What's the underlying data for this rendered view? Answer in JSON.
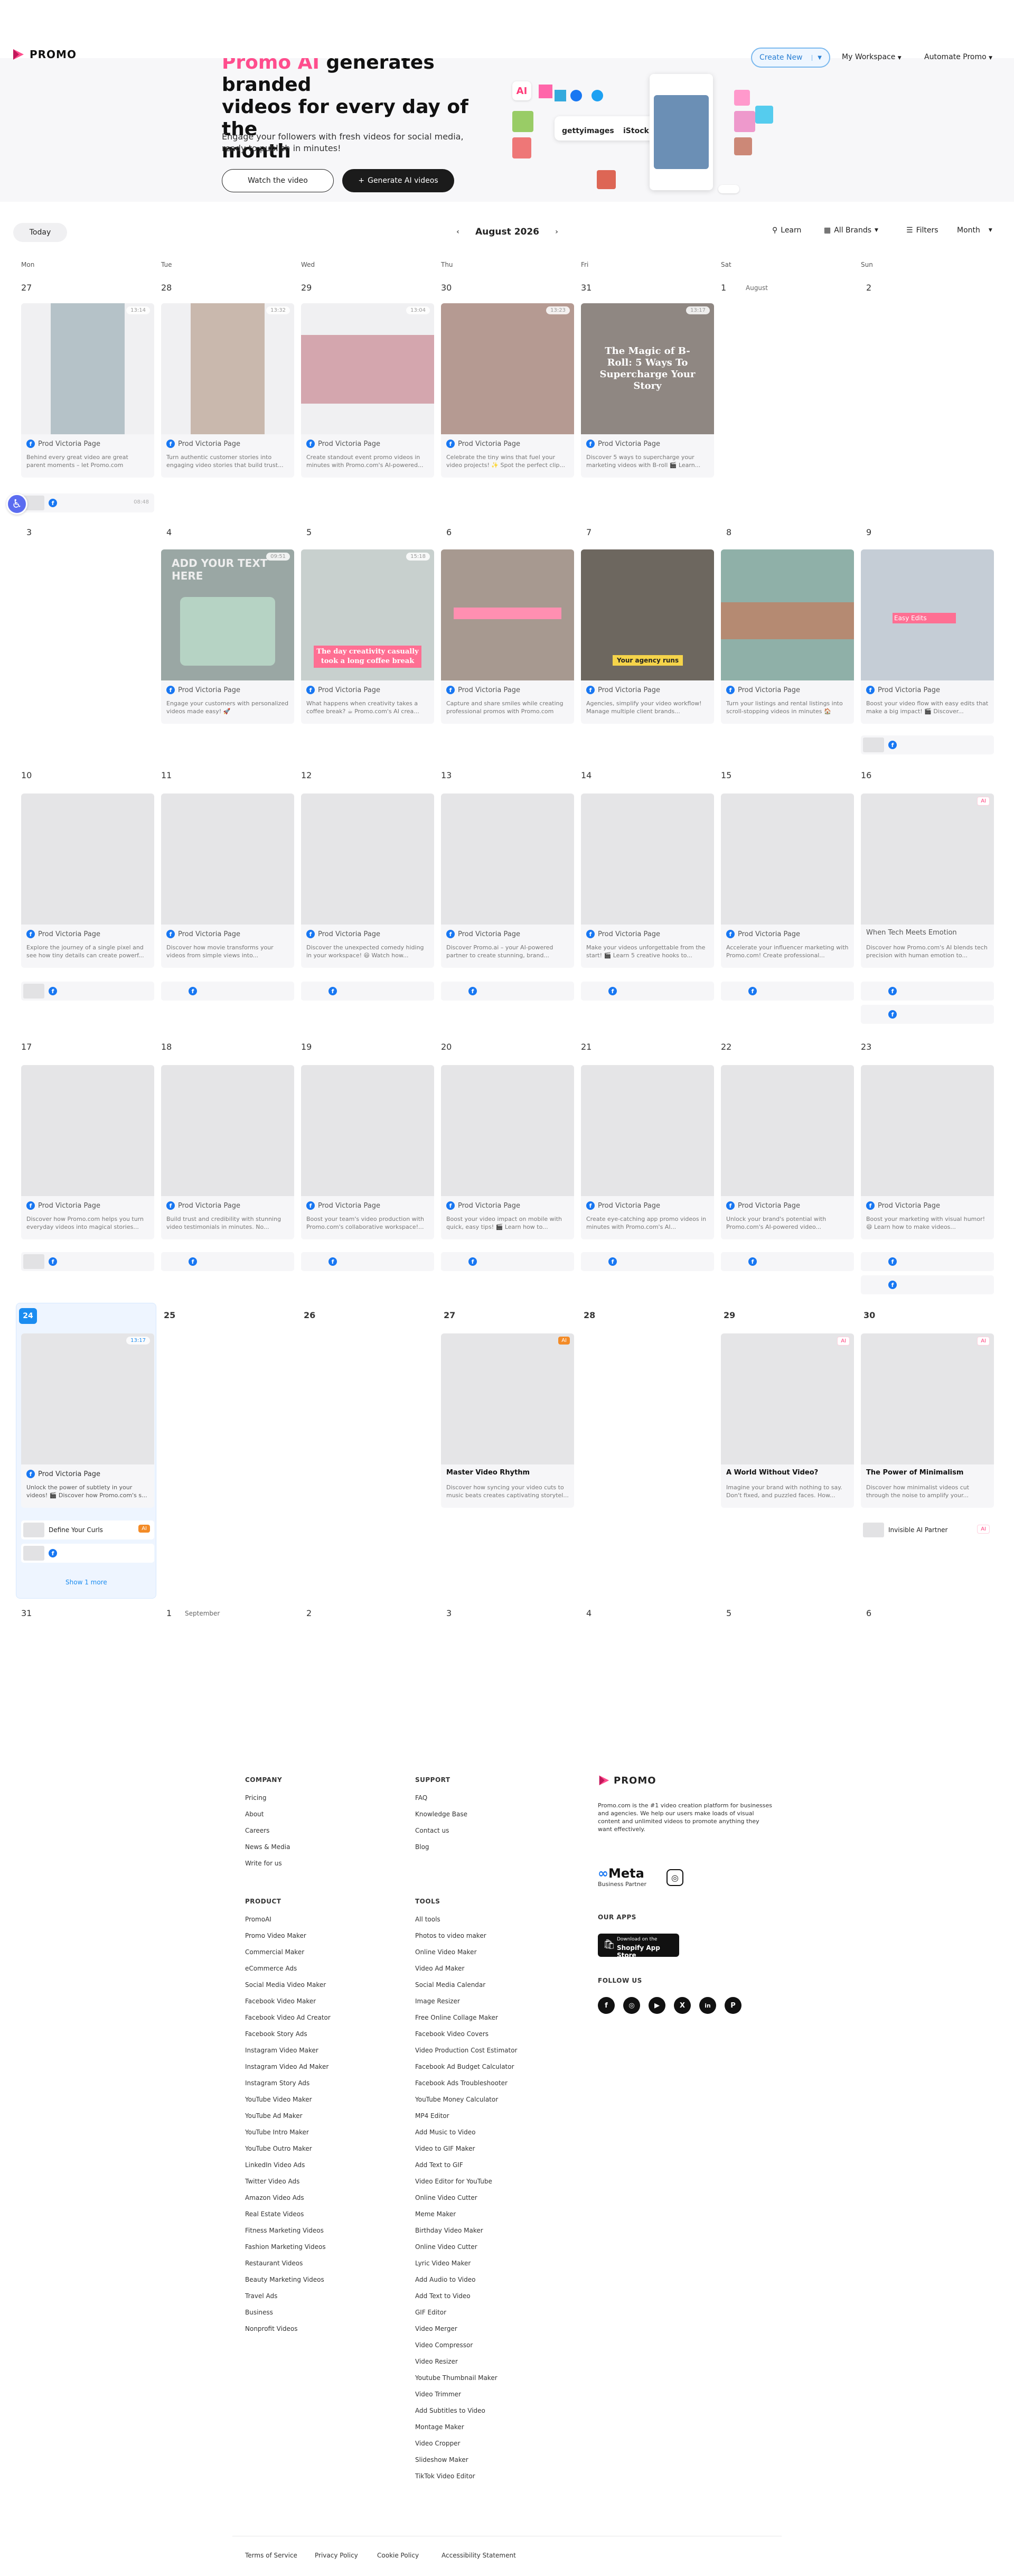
{
  "nav": {
    "logo": "PROMO",
    "create_new": "Create New",
    "my_workspace": "My Workspace",
    "automate_promo": "Automate Promo"
  },
  "hero": {
    "title_line1_pink": "Promo AI",
    "title_line1_rest": " generates branded",
    "title_line2": "videos for every day of the",
    "title_line3": "month",
    "subtitle": "Engage your followers with fresh videos for social media, ready to publish in minutes!",
    "watch_btn": "Watch the video",
    "generate_btn": "Generate AI videos",
    "collage_ai": "AI",
    "collage_getty": "gettyimages",
    "collage_istock": "iStock"
  },
  "toolbar": {
    "today": "Today",
    "month_label": "August 2026",
    "learn": "Learn",
    "brands": "All Brands",
    "filters": "Filters",
    "view": "Month"
  },
  "calendar": {
    "weekdays": [
      "Mon",
      "Tue",
      "Wed",
      "Thu",
      "Fri",
      "Sat",
      "Sun"
    ],
    "month_labels": {
      "aug": "August",
      "sep": "September"
    },
    "page_name": "Prod Victoria Page",
    "show_more": "Show 1 more",
    "days": {
      "w1": [
        "27",
        "28",
        "29",
        "30",
        "31",
        "1",
        "2"
      ],
      "w2": [
        "3",
        "4",
        "5",
        "6",
        "7",
        "8",
        "9"
      ],
      "w3": [
        "10",
        "11",
        "12",
        "13",
        "14",
        "15",
        "16"
      ],
      "w4": [
        "17",
        "18",
        "19",
        "20",
        "21",
        "22",
        "23"
      ],
      "w5": [
        "24",
        "25",
        "26",
        "27",
        "28",
        "29",
        "30"
      ],
      "w6": [
        "31",
        "1",
        "2",
        "3",
        "4",
        "5",
        "6"
      ]
    },
    "descs": {
      "w1": [
        "Behind every great video are great parent moments – let Promo.com handle...",
        "Turn authentic customer stories into engaging video stories that build trust...",
        "Create standout event promo videos in minutes with Promo.com's AI-powered...",
        "Celebrate the tiny wins that fuel your video projects! ✨ Spot the perfect clip...",
        "Discover 5 ways to supercharge your marketing videos with B-roll 🎬 Learn..."
      ],
      "w2": [
        "Engage your customers with personalized videos made easy! 🚀",
        "What happens when creativity takes a coffee break? ☕ Promo.com's AI crea...",
        "Capture and share smiles while creating professional promos with Promo.com",
        "Agencies, simplify your video workflow! Manage multiple client brands...",
        "Turn your listings and rental listings into scroll-stopping videos in minutes 🏠",
        "Boost your video flow with easy edits that make a big impact! 🎬 Discover..."
      ],
      "w3": [
        "Explore the journey of a single pixel and see how tiny details can create powerf...",
        "Discover how movie transforms your videos from simple views into...",
        "Discover the unexpected comedy hiding in your workspace! 😄 Watch how...",
        "Discover Promo.ai – your AI-powered partner to create stunning, brand...",
        "Make your videos unforgettable from the start! 🎬 Learn 5 creative hooks to...",
        "Accelerate your influencer marketing with Promo.com! Create professional...",
        "Discover how Promo.com's AI blends tech precision with human emotion to..."
      ],
      "w4": [
        "Discover how Promo.com helps you turn everyday videos into magical stories...",
        "Build trust and credibility with stunning video testimonials in minutes. No...",
        "Boost your team's video production with Promo.com's collaborative workspace!...",
        "Boost your video impact on mobile with quick, easy tips! 🎬 Learn how to...",
        "Create eye-catching app promo videos in minutes with Promo.com's AI...",
        "Unlock your brand's potential with Promo.com's AI-powered video...",
        "Boost your marketing with visual humor! 😄 Learn how to make videos..."
      ],
      "w5": [
        "Unlock the power of subtlety in your videos! 🎬 Discover how Promo.com's s...",
        "Discover how syncing your video cuts to music beats creates captivating storytel...",
        "Imagine your brand with nothing to say. Don't fixed, and puzzled faces. How...",
        "Discover how minimalist videos cut through the noise to amplify your..."
      ]
    },
    "titles": {
      "sun16": "When Tech Meets Emotion",
      "thu27": "Master Video Rhythm",
      "sat29": "A World Without Video?",
      "sun30": "The Power of Minimalism"
    },
    "mini_labels": {
      "define": "Define Your Curls",
      "invisible": "Invisible AI Partner"
    },
    "badge_ai": "AI",
    "thumb_text": {
      "fri31": "The Magic of B-Roll: 5 Ways To Supercharge Your Story",
      "tue4_a": "ADD YOUR TEXT HERE",
      "wed5": "The day creativity casually took a long coffee break",
      "fri7": "Your agency runs",
      "sun9": "Easy Edits"
    },
    "times": [
      "13:14",
      "13:32",
      "13:04",
      "13:23",
      "13:17",
      "09:51",
      "15:18",
      "08:48"
    ]
  },
  "footer": {
    "company_h": "COMPANY",
    "company": [
      "Pricing",
      "About",
      "Careers",
      "News & Media",
      "Write for us"
    ],
    "support_h": "SUPPORT",
    "support": [
      "FAQ",
      "Knowledge Base",
      "Contact us",
      "Blog"
    ],
    "product_h": "PRODUCT",
    "product": [
      "PromoAI",
      "Promo Video Maker",
      "Commercial Maker",
      "eCommerce Ads",
      "Social Media Video Maker",
      "Facebook Video Maker",
      "Facebook Video Ad Creator",
      "Facebook Story Ads",
      "Instagram Video Maker",
      "Instagram Video Ad Maker",
      "Instagram Story Ads",
      "YouTube Video Maker",
      "YouTube Ad Maker",
      "YouTube Intro Maker",
      "YouTube Outro Maker",
      "LinkedIn Video Ads",
      "Twitter Video Ads",
      "Amazon Video Ads",
      "Real Estate Videos",
      "Fitness Marketing Videos",
      "Fashion Marketing Videos",
      "Restaurant Videos",
      "Beauty Marketing Videos",
      "Travel Ads",
      "Business",
      "Nonprofit Videos"
    ],
    "tools_h": "TOOLS",
    "tools": [
      "All tools",
      "Photos to video maker",
      "Online Video Maker",
      "Video Ad Maker",
      "Social Media Calendar",
      "Image Resizer",
      "Free Online Collage Maker",
      "Facebook Video Covers",
      "Video Production Cost Estimator",
      "Facebook Ad Budget Calculator",
      "Facebook Ads Troubleshooter",
      "YouTube Money Calculator",
      "MP4 Editor",
      "Add Music to Video",
      "Video to GIF Maker",
      "Add Text to GIF",
      "Video Editor for YouTube",
      "Online Video Cutter",
      "Meme Maker",
      "Birthday Video Maker",
      "Online Video Cutter",
      "Lyric Video Maker",
      "Add Audio to Video",
      "Add Text to Video",
      "GIF Editor",
      "Video Merger",
      "Video Compressor",
      "Video Resizer",
      "Youtube Thumbnail Maker",
      "Video Trimmer",
      "Add Subtitles to Video",
      "Montage Maker",
      "Video Cropper",
      "Slideshow Maker",
      "TikTok Video Editor"
    ],
    "brand": "PROMO",
    "brand_desc": "Promo.com is the #1 video creation platform for businesses and agencies. We help our users make loads of visual content and unlimited videos to promote anything they want effectively.",
    "meta": "Meta",
    "meta_sub": "Business Partner",
    "apps_h": "OUR APPS",
    "shopify_small": "Download on the",
    "shopify": "Shopify App Store",
    "follow_h": "FOLLOW US",
    "socials": [
      "f",
      "◎",
      "▶",
      "X",
      "in",
      "P"
    ],
    "legal": [
      "Terms of Service",
      "Privacy Policy",
      "Cookie Policy",
      "Accessibility Statement"
    ]
  },
  "colors": {
    "accent": "#1b8cf0",
    "pink": "#ff4d8d",
    "dark": "#1b1b1b"
  }
}
